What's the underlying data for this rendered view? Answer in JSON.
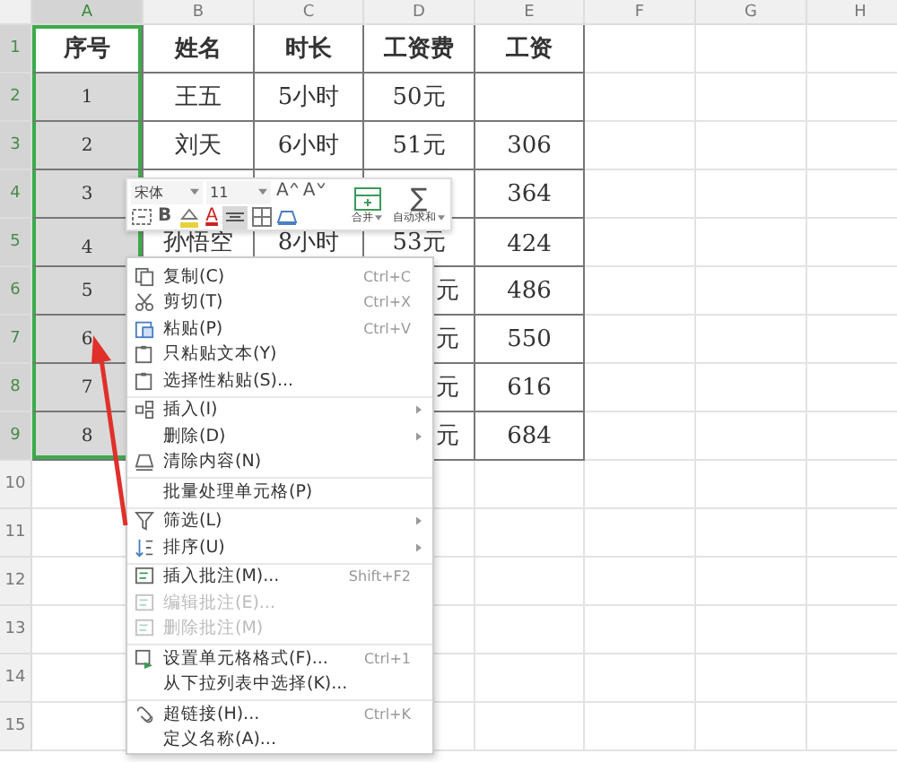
{
  "columns": [
    {
      "label": "A",
      "selected": true
    },
    {
      "label": "B",
      "selected": false
    },
    {
      "label": "C",
      "selected": false
    },
    {
      "label": "D",
      "selected": false
    },
    {
      "label": "E",
      "selected": false
    },
    {
      "label": "F",
      "selected": false
    },
    {
      "label": "G",
      "selected": false
    },
    {
      "label": "H",
      "selected": false
    }
  ],
  "rows": [
    {
      "number": "1",
      "selected": true,
      "active": true,
      "kind": "header",
      "cells": {
        "A": "序号",
        "B": "姓名",
        "C": "时长",
        "D": "工资费",
        "E": "工资"
      }
    },
    {
      "number": "2",
      "selected": true,
      "active": false,
      "kind": "full",
      "cells": {
        "A": "1",
        "B": "王五",
        "C": "5小时",
        "D": "50元"
      }
    },
    {
      "number": "3",
      "selected": true,
      "active": false,
      "kind": "full",
      "cells": {
        "A": "2",
        "B": "刘天",
        "C": "6小时",
        "D": "51元",
        "E": "306"
      }
    },
    {
      "number": "4",
      "selected": true,
      "active": false,
      "kind": "under_toolbar",
      "cells": {
        "A": "3",
        "E": "364"
      }
    },
    {
      "number": "5",
      "selected": true,
      "active": false,
      "kind": "below_toolbar",
      "cells": {
        "A": "4",
        "B": "孙悟空",
        "C": "8小时",
        "D": "53元",
        "E": "424"
      }
    },
    {
      "number": "6",
      "selected": true,
      "active": false,
      "kind": "under_menu",
      "cells": {
        "A": "5",
        "D": "元",
        "E": "486"
      }
    },
    {
      "number": "7",
      "selected": true,
      "active": false,
      "kind": "under_menu",
      "cells": {
        "A": "6",
        "D": "元",
        "E": "550"
      }
    },
    {
      "number": "8",
      "selected": true,
      "active": false,
      "kind": "under_menu",
      "cells": {
        "A": "7",
        "D": "元",
        "E": "616"
      }
    },
    {
      "number": "9",
      "selected": true,
      "active": false,
      "kind": "under_menu",
      "cells": {
        "A": "8",
        "D": "元",
        "E": "684"
      }
    },
    {
      "number": "10",
      "selected": false,
      "active": false,
      "kind": "full",
      "cells": {}
    },
    {
      "number": "11",
      "selected": false,
      "active": false,
      "kind": "full",
      "cells": {}
    },
    {
      "number": "12",
      "selected": false,
      "active": false,
      "kind": "full",
      "cells": {}
    },
    {
      "number": "13",
      "selected": false,
      "active": false,
      "kind": "full",
      "cells": {}
    },
    {
      "number": "14",
      "selected": false,
      "active": false,
      "kind": "full",
      "cells": {}
    },
    {
      "number": "15",
      "selected": false,
      "active": false,
      "kind": "full",
      "cells": {}
    }
  ],
  "toolbar": {
    "font": "宋体",
    "size": "11",
    "grow_font": "A",
    "shrink_font": "A",
    "sum": "∑",
    "bold": "B",
    "font_color": "A",
    "align_selected": true,
    "merge": "合并",
    "autosum": "自动求和"
  },
  "context_menu": [
    {
      "label": "复制(C)",
      "shortcut": "Ctrl+C",
      "submenu": false,
      "disabled": false,
      "separator_before": false
    },
    {
      "label": "剪切(T)",
      "shortcut": "Ctrl+X",
      "submenu": false,
      "disabled": false,
      "separator_before": false
    },
    {
      "label": "粘贴(P)",
      "shortcut": "Ctrl+V",
      "submenu": false,
      "disabled": false,
      "separator_before": false
    },
    {
      "label": "只粘贴文本(Y)",
      "submenu": false,
      "disabled": false,
      "separator_before": false
    },
    {
      "label": "选择性粘贴(S)...",
      "submenu": false,
      "disabled": false,
      "separator_before": false
    },
    {
      "label": "插入(I)",
      "submenu": true,
      "disabled": false,
      "separator_before": true
    },
    {
      "label": "删除(D)",
      "submenu": true,
      "disabled": false,
      "separator_before": false
    },
    {
      "label": "清除内容(N)",
      "submenu": false,
      "disabled": false,
      "separator_before": false
    },
    {
      "label": "批量处理单元格(P)",
      "submenu": false,
      "disabled": false,
      "separator_before": true
    },
    {
      "label": "筛选(L)",
      "submenu": true,
      "disabled": false,
      "separator_before": true
    },
    {
      "label": "排序(U)",
      "submenu": true,
      "disabled": false,
      "separator_before": false
    },
    {
      "label": "插入批注(M)...",
      "shortcut": "Shift+F2",
      "submenu": false,
      "disabled": false,
      "separator_before": true
    },
    {
      "label": "编辑批注(E)...",
      "submenu": false,
      "disabled": true,
      "separator_before": false
    },
    {
      "label": "删除批注(M)",
      "submenu": false,
      "disabled": true,
      "separator_before": false
    },
    {
      "label": "设置单元格格式(F)...",
      "shortcut": "Ctrl+1",
      "submenu": false,
      "disabled": false,
      "separator_before": true
    },
    {
      "label": "从下拉列表中选择(K)...",
      "submenu": false,
      "disabled": false,
      "separator_before": false
    },
    {
      "label": "超链接(H)...",
      "shortcut": "Ctrl+K",
      "submenu": false,
      "disabled": false,
      "separator_before": true
    },
    {
      "label": "定义名称(A)...",
      "submenu": false,
      "disabled": false,
      "separator_before": false
    }
  ]
}
